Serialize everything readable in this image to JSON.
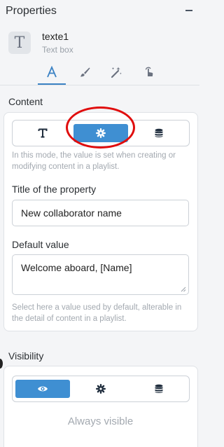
{
  "panel": {
    "title": "Properties"
  },
  "element": {
    "name": "texte1",
    "type": "Text box",
    "icon": "text-T-icon"
  },
  "tabs": [
    {
      "icon": "text-format-icon",
      "active": true
    },
    {
      "icon": "brush-icon",
      "active": false
    },
    {
      "icon": "magic-wand-icon",
      "active": false
    },
    {
      "icon": "tap-hand-icon",
      "active": false
    }
  ],
  "content": {
    "title": "Content",
    "modes": [
      {
        "icon": "text-T-icon",
        "active": false
      },
      {
        "icon": "gear-icon",
        "active": true
      },
      {
        "icon": "database-icon",
        "active": false
      }
    ],
    "mode_help": "In this mode, the value is set when creating or modifying content in a playlist.",
    "property_title_label": "Title of the property",
    "property_title_value": "New collaborator name",
    "default_value_label": "Default value",
    "default_value": "Welcome aboard, [Name]",
    "default_help": "Select here a value used by default, alterable in the detail of content in a playlist."
  },
  "visibility": {
    "title": "Visibility",
    "modes": [
      {
        "icon": "eye-icon",
        "active": true
      },
      {
        "icon": "gear-icon",
        "active": false
      },
      {
        "icon": "database-icon",
        "active": false
      }
    ],
    "status": "Always visible"
  },
  "colors": {
    "accent": "#3f8fd2",
    "annotation": "#e00d0d",
    "text_dark": "#1f2d3d"
  }
}
